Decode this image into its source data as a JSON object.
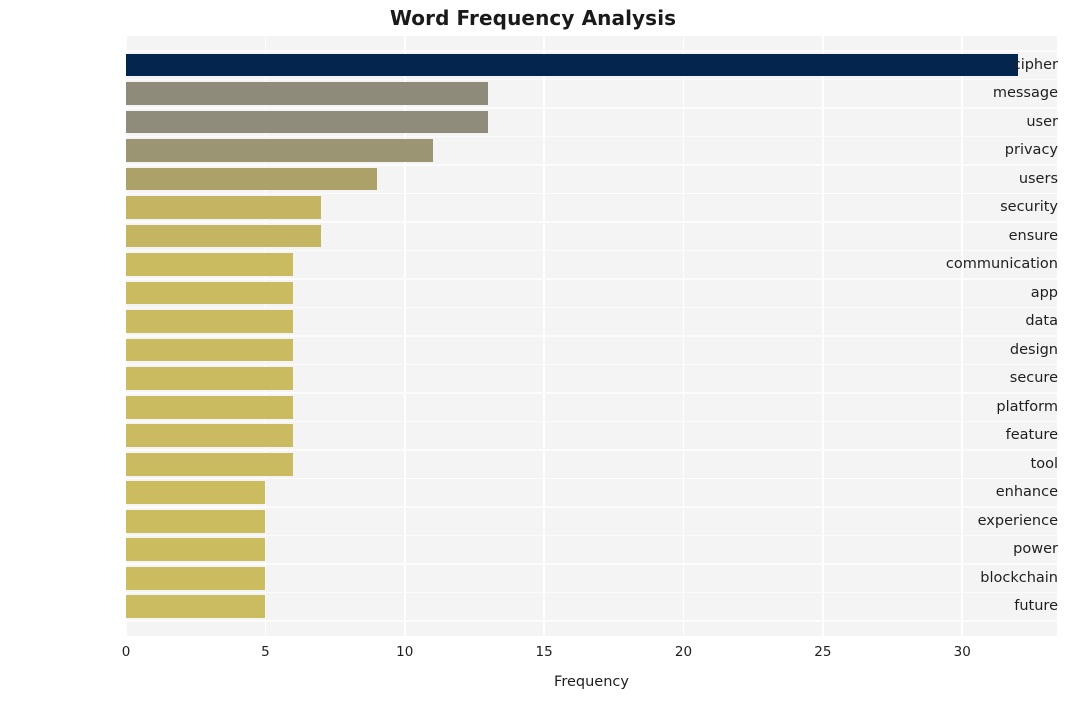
{
  "chart_data": {
    "type": "bar",
    "orientation": "horizontal",
    "title": "Word Frequency Analysis",
    "xlabel": "Frequency",
    "ylabel": "",
    "categories": [
      "cipher",
      "message",
      "user",
      "privacy",
      "users",
      "security",
      "ensure",
      "communication",
      "app",
      "data",
      "design",
      "secure",
      "platform",
      "feature",
      "tool",
      "enhance",
      "experience",
      "power",
      "blockchain",
      "future"
    ],
    "values": [
      32,
      13,
      13,
      11,
      9,
      7,
      7,
      6,
      6,
      6,
      6,
      6,
      6,
      6,
      6,
      5,
      5,
      5,
      5,
      5
    ],
    "bar_colors": [
      "#04254e",
      "#8f8b7a",
      "#908c7b",
      "#9c9573",
      "#aca169",
      "#c4b563",
      "#c4b563",
      "#cabb60",
      "#cabb60",
      "#cabb60",
      "#cabb60",
      "#cabb60",
      "#cabb60",
      "#cabb60",
      "#cabb60",
      "#cbbc5f",
      "#cbbc5f",
      "#cbbc5f",
      "#cbbc5f",
      "#cbbc5f"
    ],
    "xlim": [
      0,
      33.4
    ],
    "xticks": [
      0,
      5,
      10,
      15,
      20,
      25,
      30
    ],
    "xtick_labels": [
      "0",
      "5",
      "10",
      "15",
      "20",
      "25",
      "30"
    ],
    "grid": true,
    "grid_color": "#ffffff",
    "plot_background": "#f4f4f5",
    "figure_background": "#ffffff",
    "legend": null
  }
}
